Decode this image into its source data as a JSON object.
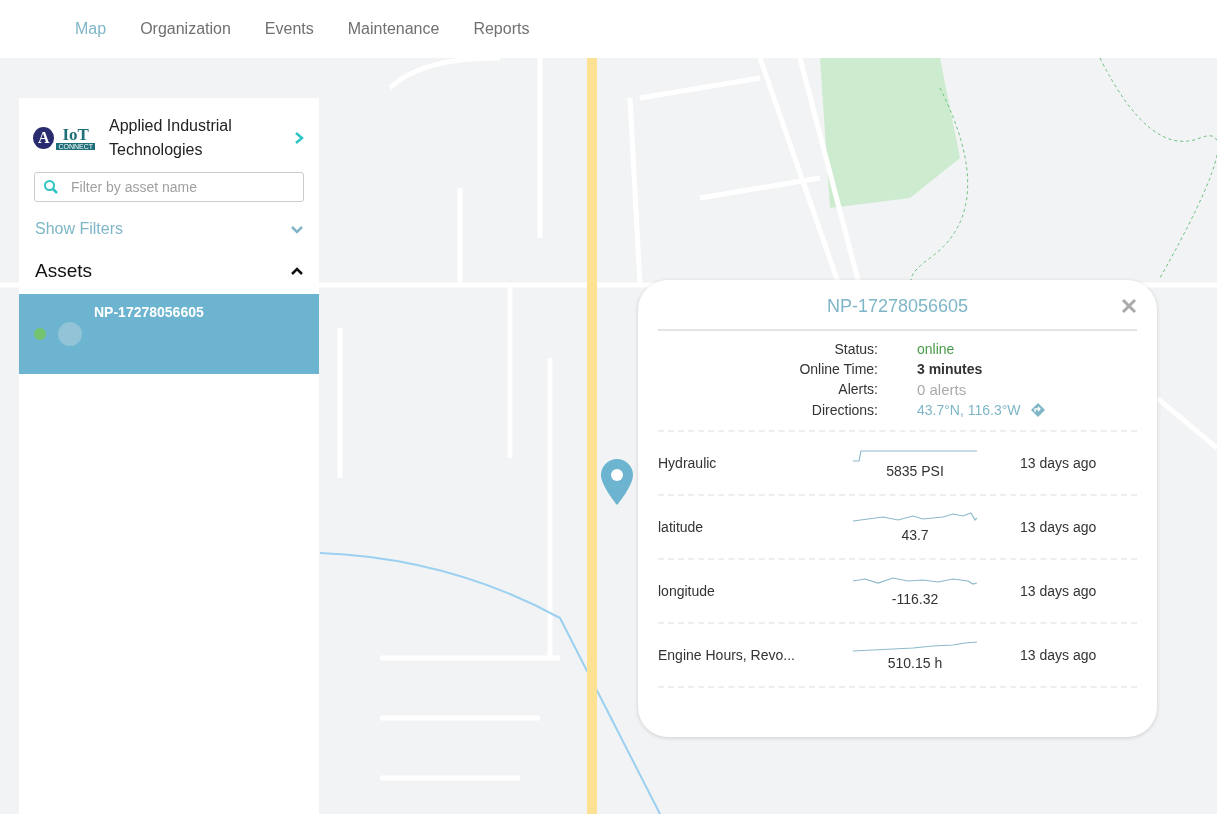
{
  "nav": {
    "tabs": [
      {
        "label": "Map",
        "selected": true
      },
      {
        "label": "Organization",
        "selected": false
      },
      {
        "label": "Events",
        "selected": false
      },
      {
        "label": "Maintenance",
        "selected": false
      },
      {
        "label": "Reports",
        "selected": false
      }
    ]
  },
  "sidebar": {
    "logo": {
      "letter": "A",
      "word": "IoT",
      "tagline": "CONNECT"
    },
    "company": "Applied Industrial Technologies",
    "search": {
      "placeholder": "Filter by asset name"
    },
    "filters": {
      "label": "Show Filters",
      "expanded": false
    },
    "assets_section": {
      "title": "Assets",
      "expanded": true
    },
    "assets": [
      {
        "name": "NP-17278056605",
        "selected": true,
        "online": true
      }
    ]
  },
  "popup": {
    "title": "NP-17278056605",
    "details": [
      {
        "label": "Status:",
        "value": "online",
        "kind": "status"
      },
      {
        "label": "Online Time:",
        "value": "3 minutes",
        "kind": "bold"
      },
      {
        "label": "Alerts:",
        "value": "0 alerts",
        "kind": "muted"
      },
      {
        "label": "Directions:",
        "value": "43.7°N, 116.3°W",
        "kind": "link"
      }
    ],
    "metrics": [
      {
        "name": "Hydraulic",
        "reading": "5835 PSI",
        "updated": "13 days ago"
      },
      {
        "name": "latitude",
        "reading": "43.7",
        "updated": "13 days ago"
      },
      {
        "name": "longitude",
        "reading": "-116.32",
        "updated": "13 days ago"
      },
      {
        "name": "Engine Hours, Revo...",
        "reading": "510.15 h",
        "updated": "13 days ago"
      }
    ]
  }
}
